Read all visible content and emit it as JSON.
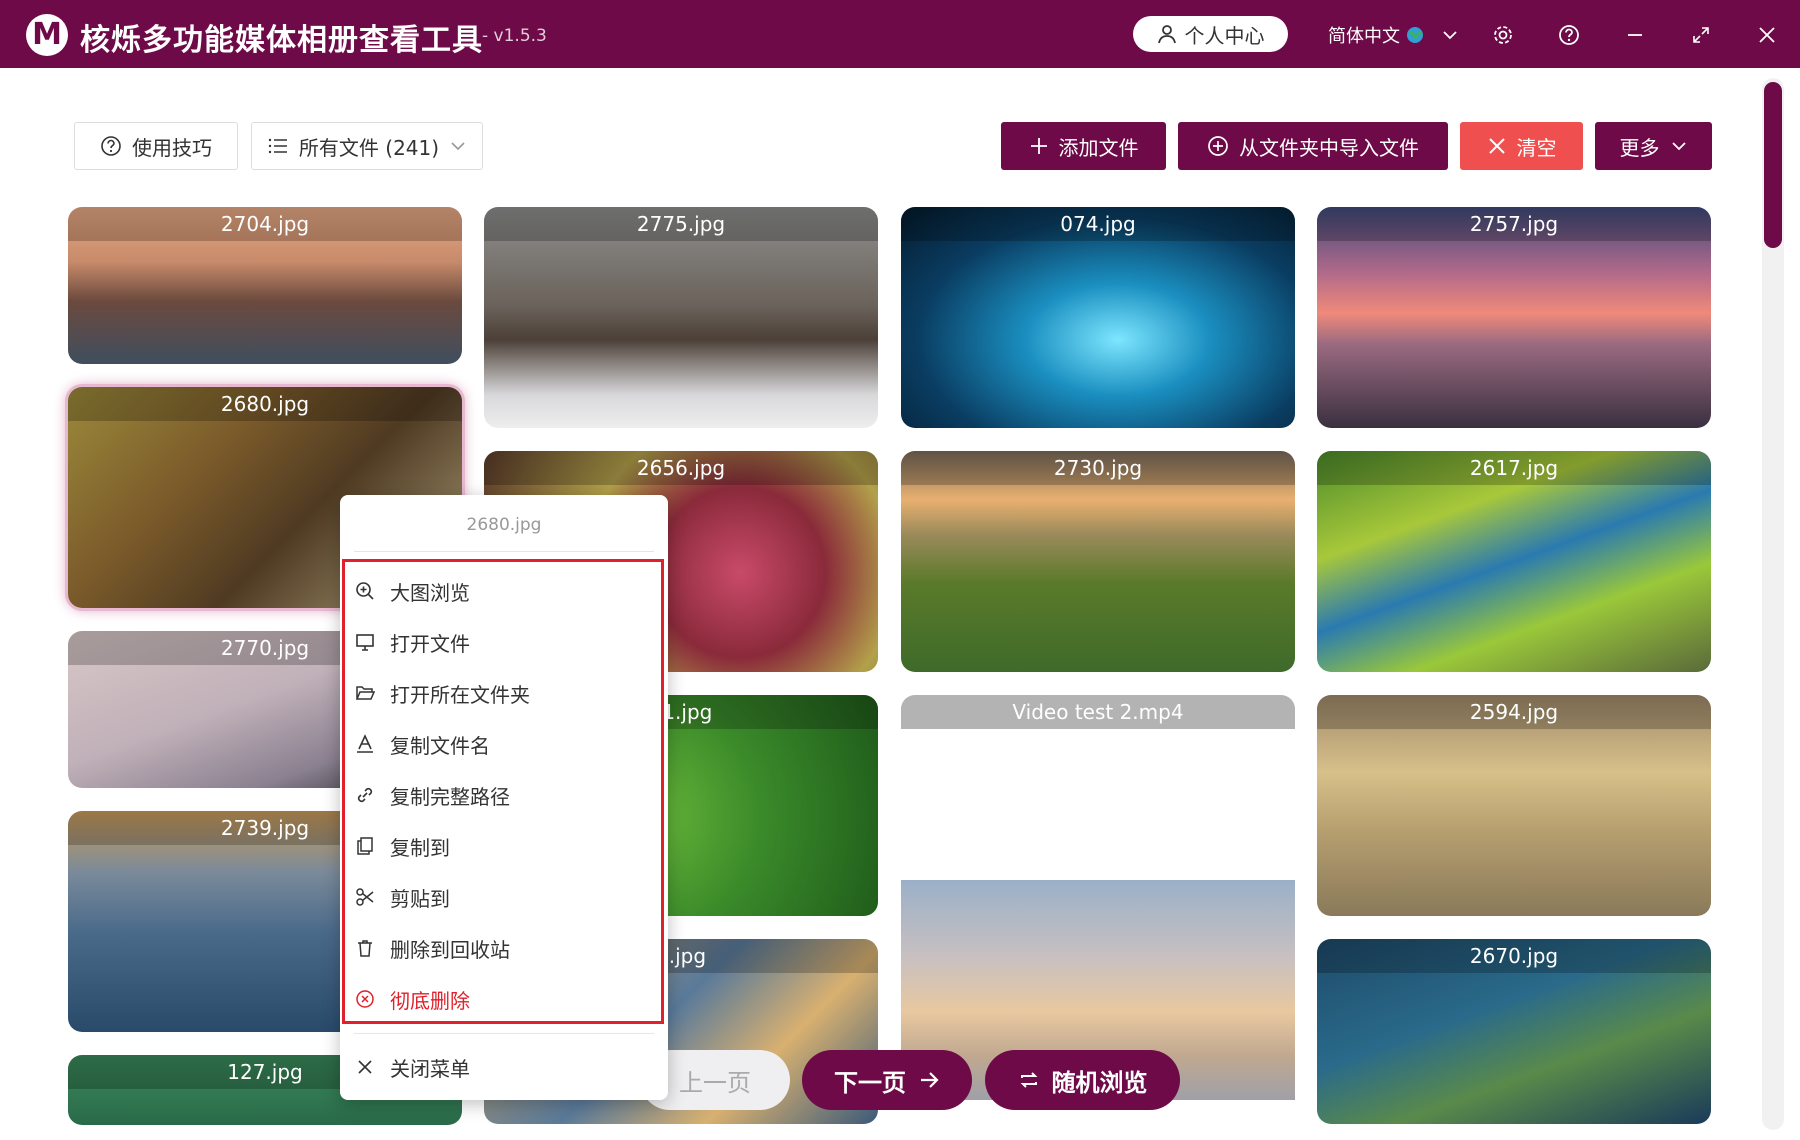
{
  "titlebar": {
    "logo_letter": "M",
    "title": "核烁多功能媒体相册查看工具",
    "version": "- v1.5.3",
    "user_center": "个人中心",
    "language": "简体中文"
  },
  "toolbar": {
    "tips": "使用技巧",
    "all_files": "所有文件 (241)",
    "add_file": "添加文件",
    "import_folder": "从文件夹中导入文件",
    "clear": "清空",
    "more": "更多"
  },
  "gallery": [
    {
      "name": "2704.jpg"
    },
    {
      "name": "2775.jpg"
    },
    {
      "name": "074.jpg"
    },
    {
      "name": "2757.jpg"
    },
    {
      "name": "2680.jpg"
    },
    {
      "name": "2656.jpg"
    },
    {
      "name": "2730.jpg"
    },
    {
      "name": "2617.jpg"
    },
    {
      "name": "2770.jpg"
    },
    {
      "name": "41.jpg"
    },
    {
      "name": "Video test 2.mp4"
    },
    {
      "name": "2594.jpg"
    },
    {
      "name": "2739.jpg"
    },
    {
      "name": "1.jpg"
    },
    {
      "name": "2670.jpg"
    },
    {
      "name": "127.jpg"
    }
  ],
  "context_menu": {
    "title": "2680.jpg",
    "items": [
      {
        "label": "大图浏览",
        "icon": "zoom-in-icon"
      },
      {
        "label": "打开文件",
        "icon": "monitor-icon"
      },
      {
        "label": "打开所在文件夹",
        "icon": "folder-open-icon"
      },
      {
        "label": "复制文件名",
        "icon": "text-icon"
      },
      {
        "label": "复制完整路径",
        "icon": "link-icon"
      },
      {
        "label": "复制到",
        "icon": "copy-icon"
      },
      {
        "label": "剪贴到",
        "icon": "scissors-icon"
      },
      {
        "label": "删除到回收站",
        "icon": "trash-icon"
      },
      {
        "label": "彻底删除",
        "icon": "close-circle-icon"
      }
    ],
    "close": "关闭菜单"
  },
  "pager": {
    "prev": "上一页",
    "next": "下一页",
    "random": "随机浏览"
  },
  "colors": {
    "brand": "#6d0a47",
    "danger": "#f04f4f"
  }
}
